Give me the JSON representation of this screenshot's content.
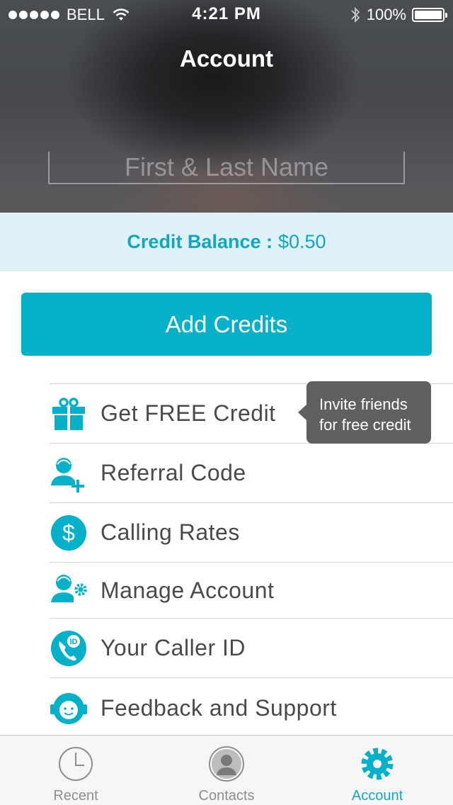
{
  "status_bar": {
    "carrier": "BELL",
    "time": "4:21 PM",
    "battery": "100%"
  },
  "header": {
    "title": "Account",
    "name_placeholder": "First & Last Name"
  },
  "balance": {
    "label": "Credit Balance :",
    "value": "$0.50"
  },
  "add_credits": {
    "label": "Add Credits"
  },
  "menu": {
    "items": [
      {
        "label": "Get FREE Credit",
        "icon": "gift-icon"
      },
      {
        "label": "Referral Code",
        "icon": "add-user-icon"
      },
      {
        "label": "Calling Rates",
        "icon": "dollar-icon"
      },
      {
        "label": "Manage Account",
        "icon": "user-gear-icon"
      },
      {
        "label": "Your Caller ID",
        "icon": "phone-id-icon"
      },
      {
        "label": "Feedback and Support",
        "icon": "support-headset-icon"
      }
    ]
  },
  "tooltip": {
    "line1": "Invite friends",
    "line2": "for free credit"
  },
  "tabbar": {
    "tabs": [
      {
        "label": "Recent",
        "icon": "clock-icon"
      },
      {
        "label": "Contacts",
        "icon": "contact-icon"
      },
      {
        "label": "Account",
        "icon": "gear-icon",
        "active": true
      }
    ]
  },
  "colors": {
    "accent": "#05b0c9",
    "accent_text": "#12a6c2",
    "balance_bg": "#dff2f7",
    "tooltip_bg": "#606060"
  }
}
